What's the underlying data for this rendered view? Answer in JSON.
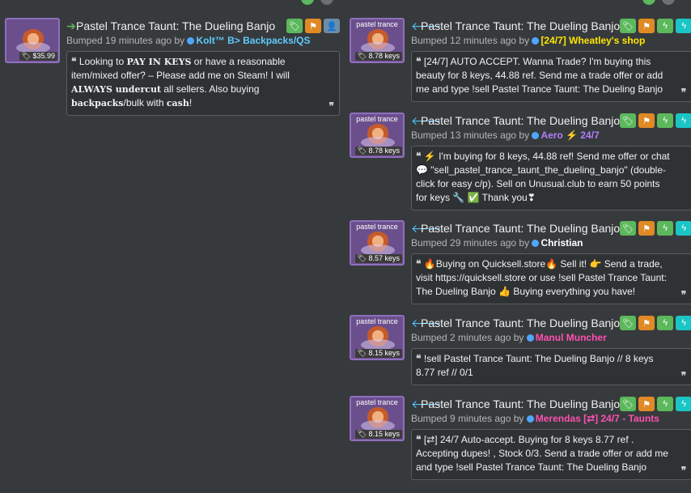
{
  "colors": {
    "background": "#373a3c",
    "effect_purple": "#6b4f8c",
    "user_yellow": "#ffe600",
    "user_purple": "#b07fff",
    "user_pink": "#ff4fb3",
    "user_white": "#ffffff",
    "user_blue": "#5ecbff"
  },
  "left": {
    "listing": {
      "title": "Pastel Trance Taunt: The Dueling Banjo",
      "price": "$35.99",
      "bumped": "Bumped 19 minutes ago by",
      "user": "Kolt™ B> Backpacks/QS",
      "comment_a": "Looking to ",
      "comment_b": "PAY IN KEYS",
      "comment_c": " or have a reasonable item/mixed offer? – Please add me on Steam! I will ",
      "comment_d": "ALWAYS undercut",
      "comment_e": " all sellers. Also buying ",
      "comment_f": "backpacks",
      "comment_g": "/bulk with ",
      "comment_h": "cash",
      "comment_i": "!"
    }
  },
  "right": {
    "listings": [
      {
        "effect": "pastel trance",
        "price": "8.78 keys",
        "title": "Pastel Trance Taunt: The Dueling Banjo",
        "bumped": "Bumped 12 minutes ago by",
        "user": "[24/7] Wheatley's shop",
        "comment": "[24/7] AUTO ACCEPT. Wanna Trade? I'm buying this beauty for 8 keys, 44.88 ref. Send me a trade offer or add me and type !sell Pastel Trance Taunt: The Dueling Banjo"
      },
      {
        "effect": "pastel trance",
        "price": "8.78 keys",
        "title": "Pastel Trance Taunt: The Dueling Banjo",
        "bumped": "Bumped 13 minutes ago by",
        "user": "Aero ⚡ 24/7",
        "comment": "⚡ I'm buying for 8 keys, 44.88 ref! Send me offer or chat 💬 \"sell_pastel_trance_taunt_the_dueling_banjo\" (double-click for easy c/p). Sell on Unusual.club to earn 50 points for keys 🔧 ✅ Thank you❣"
      },
      {
        "effect": "pastel trance",
        "price": "8.57 keys",
        "title": "Pastel Trance Taunt: The Dueling Banjo",
        "bumped": "Bumped 29 minutes ago by",
        "user": "Christian",
        "comment": "🔥Buying on Quicksell.store🔥 Sell it! 👉 Send a trade, visit https://quicksell.store or use !sell Pastel Trance Taunt: The Dueling Banjo 👍 Buying everything you have!"
      },
      {
        "effect": "pastel trance",
        "price": "8.15 keys",
        "title": "Pastel Trance Taunt: The Dueling Banjo",
        "bumped": "Bumped 2 minutes ago by",
        "user": "Manul Muncher",
        "comment": "!sell Pastel Trance Taunt: The Dueling Banjo // 8 keys 8.77 ref // 0/1"
      },
      {
        "effect": "pastel trance",
        "price": "8.15 keys",
        "title": "Pastel Trance Taunt: The Dueling Banjo",
        "bumped": "Bumped 9 minutes ago by",
        "user": "Merendas [⇄] 24/7 - Taunts",
        "comment": "[⇄] 24/7 Auto-accept. Buying for 8 keys 8.77 ref . Accepting dupes! , Stock 0/3. Send a trade offer or add me and type !sell Pastel Trance Taunt: The Dueling Banjo"
      }
    ]
  }
}
